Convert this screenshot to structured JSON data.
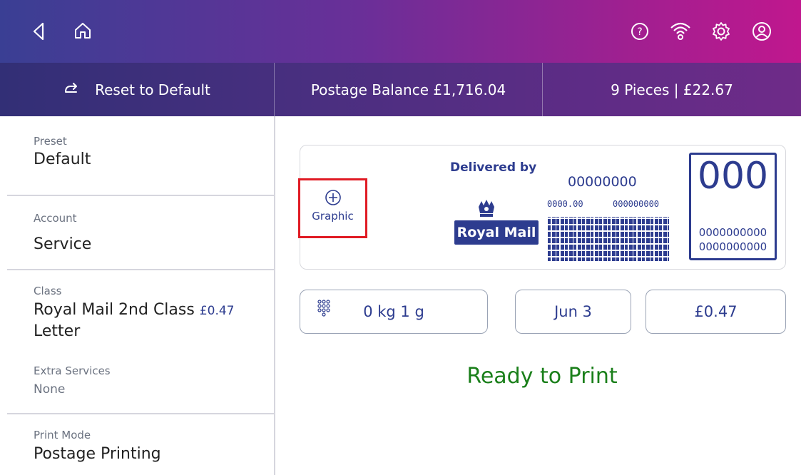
{
  "topbar": {
    "icons": [
      "back-icon",
      "home-icon",
      "help-icon",
      "wifi-icon",
      "settings-icon",
      "account-icon"
    ]
  },
  "statusbar": {
    "reset_label": "Reset to Default",
    "postage_balance": "Postage Balance £1,716.04",
    "pieces": "9 Pieces | £22.67"
  },
  "sidebar": {
    "preset": {
      "label": "Preset",
      "value": "Default"
    },
    "account": {
      "label": "Account",
      "value": "Service"
    },
    "class": {
      "label": "Class",
      "value_line1": "Royal Mail 2nd Class",
      "price": "£0.47",
      "value_line2": "Letter"
    },
    "extra": {
      "label": "Extra Services",
      "value": "None"
    },
    "print_mode": {
      "label": "Print Mode",
      "value": "Postage Printing"
    }
  },
  "indicia": {
    "graphic_label": "Graphic",
    "delivered_by": "Delivered by",
    "number_top": "00000000",
    "small_left": "0000.00",
    "small_right": "000000000",
    "logo_text": "Royal Mail",
    "big_digits": "000",
    "box_line1": "0000000000",
    "box_line2": "0000000000"
  },
  "controls": {
    "weight": "0 kg 1 g",
    "date": "Jun 3",
    "amount": "£0.47"
  },
  "ready_text": "Ready to Print",
  "colors": {
    "accent_blue": "#2d3c8f",
    "ready_green": "#1a7f1a",
    "highlight_red": "#e01b24"
  }
}
